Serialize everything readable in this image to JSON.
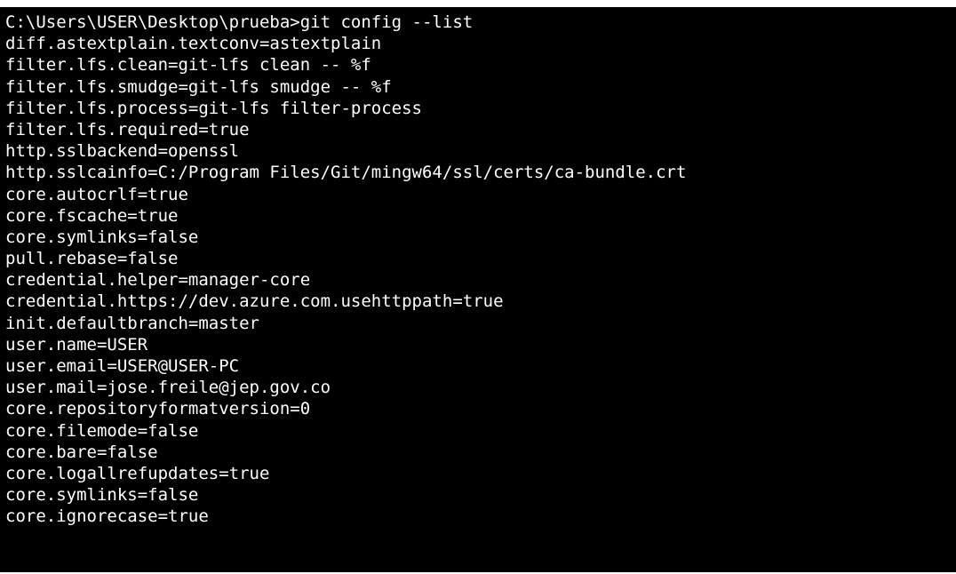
{
  "window": {
    "top_fragment": "",
    "background_color": "#000000",
    "text_color": "#ffffff"
  },
  "terminal": {
    "lines": [
      "C:\\Users\\USER\\Desktop\\prueba>git config --list",
      "diff.astextplain.textconv=astextplain",
      "filter.lfs.clean=git-lfs clean -- %f",
      "filter.lfs.smudge=git-lfs smudge -- %f",
      "filter.lfs.process=git-lfs filter-process",
      "filter.lfs.required=true",
      "http.sslbackend=openssl",
      "http.sslcainfo=C:/Program Files/Git/mingw64/ssl/certs/ca-bundle.crt",
      "core.autocrlf=true",
      "core.fscache=true",
      "core.symlinks=false",
      "pull.rebase=false",
      "credential.helper=manager-core",
      "credential.https://dev.azure.com.usehttppath=true",
      "init.defaultbranch=master",
      "user.name=USER",
      "user.email=USER@USER-PC",
      "user.mail=jose.freile@jep.gov.co",
      "core.repositoryformatversion=0",
      "core.filemode=false",
      "core.bare=false",
      "core.logallrefupdates=true",
      "core.symlinks=false",
      "core.ignorecase=true"
    ]
  }
}
